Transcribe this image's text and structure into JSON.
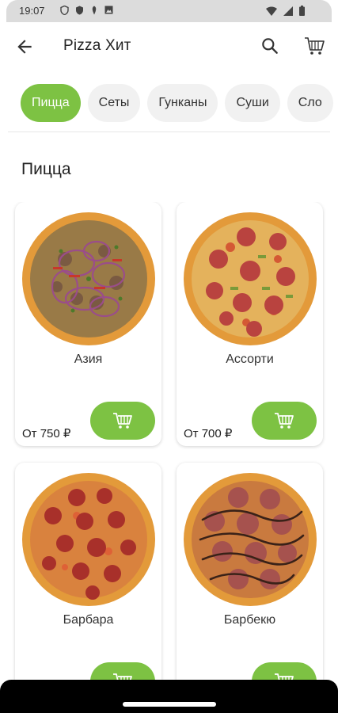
{
  "status": {
    "time": "19:07"
  },
  "header": {
    "title": "Pizza Хит"
  },
  "chips": [
    "Пицца",
    "Сеты",
    "Гунканы",
    "Суши",
    "Сло"
  ],
  "section_title": "Пицца",
  "products": [
    {
      "name": "Азия",
      "price": "От 750 ₽"
    },
    {
      "name": "Ассорти",
      "price": "От 700 ₽"
    },
    {
      "name": "Барбара",
      "price": ""
    },
    {
      "name": "Барбекю",
      "price": ""
    }
  ],
  "colors": {
    "accent": "#7dc243",
    "crust": "#e39a3a",
    "sauce": "#d9532b",
    "pepperoni": "#a8302a"
  }
}
